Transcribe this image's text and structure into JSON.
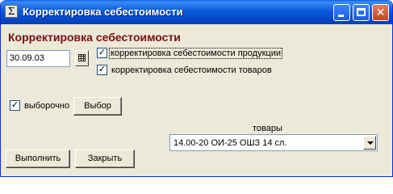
{
  "window": {
    "title": "Корректировка себестоимости",
    "icon_glyph": "Σ"
  },
  "form": {
    "heading": "Корректировка себестоимости",
    "date_value": "30.09.03",
    "check_products": {
      "label": "корректировка себестоимости продукции",
      "checked": true
    },
    "check_goods": {
      "label": "корректировка себестоимости товаров",
      "checked": true
    },
    "check_selective": {
      "label": "выборочно",
      "checked": true
    },
    "select_button": "Выбор",
    "goods_label": "товары",
    "goods_selected": "14.00-20 ОИ-25 ОШЗ 14 сл.",
    "run_button": "Выполнить",
    "close_button": "Закрыть"
  },
  "colors": {
    "titlebar": "#0a5bd8",
    "heading": "#7a1010",
    "face": "#ece9d8"
  }
}
